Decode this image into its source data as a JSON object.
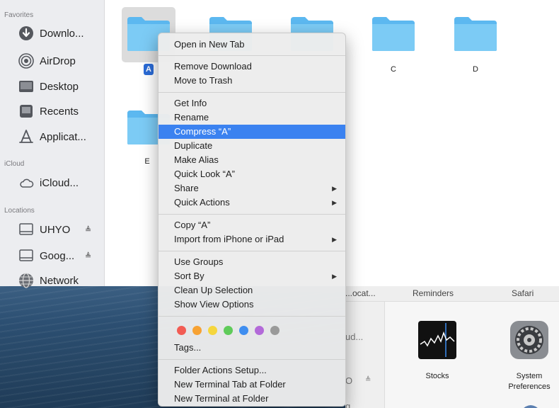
{
  "sidebar": {
    "favorites_heading": "Favorites",
    "favorites": [
      {
        "label": "Downlo...",
        "icon": "download-circle-icon"
      },
      {
        "label": "AirDrop",
        "icon": "airdrop-icon"
      },
      {
        "label": "Desktop",
        "icon": "desktop-icon"
      },
      {
        "label": "Recents",
        "icon": "recents-icon"
      },
      {
        "label": "Applicat...",
        "icon": "applications-icon"
      }
    ],
    "icloud_heading": "iCloud",
    "icloud": [
      {
        "label": "iCloud...",
        "icon": "cloud-icon"
      }
    ],
    "locations_heading": "Locations",
    "locations": [
      {
        "label": "UHYO",
        "icon": "drive-icon",
        "eject": "≜"
      },
      {
        "label": "Goog...",
        "icon": "drive-icon",
        "eject": "≜"
      },
      {
        "label": "Network",
        "icon": "network-globe-icon"
      }
    ]
  },
  "folders": [
    {
      "label": "A",
      "selected": true
    },
    {
      "label": ""
    },
    {
      "label": ""
    },
    {
      "label": "C"
    },
    {
      "label": "D"
    },
    {
      "label": "E"
    }
  ],
  "context_menu": {
    "groups": [
      [
        "Open in New Tab"
      ],
      [
        "Remove Download",
        "Move to Trash"
      ],
      [
        "Get Info",
        "Rename",
        "Compress “A”",
        "Duplicate",
        "Make Alias",
        "Quick Look “A”",
        "Share",
        "Quick Actions"
      ],
      [
        "Copy “A”",
        "Import from iPhone or iPad"
      ],
      [
        "Use Groups",
        "Sort By",
        "Clean Up Selection",
        "Show View Options"
      ],
      [
        "Tags..."
      ],
      [
        "Folder Actions Setup...",
        "New Terminal Tab at Folder",
        "New Terminal at Folder"
      ]
    ],
    "highlighted": "Compress “A”",
    "submenu_items": [
      "Share",
      "Quick Actions",
      "Import from iPhone or iPad",
      "Sort By"
    ],
    "tag_colors": [
      "#f25c54",
      "#f7a233",
      "#f5d63d",
      "#5fcb5a",
      "#3f8ef0",
      "#b36ad9",
      "#9a9a9a"
    ]
  },
  "background_window": {
    "column_labels": [
      "...ocat...",
      "Reminders",
      "Safari"
    ],
    "side_texts": [
      "ud...",
      "O",
      "g"
    ],
    "apps": [
      {
        "label": "Stocks",
        "icon": "stocks-app-icon"
      },
      {
        "label": "System Preferences",
        "icon": "system-preferences-icon"
      }
    ]
  },
  "colors": {
    "accent": "#3b82f0",
    "folder": "#5cb8f0",
    "folder_tab": "#7ccbf5"
  }
}
